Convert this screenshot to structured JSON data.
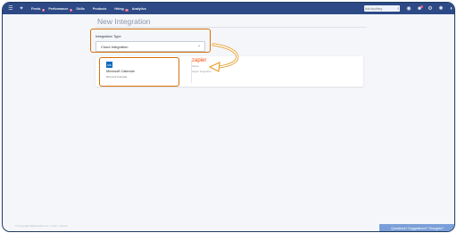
{
  "nav": {
    "items": [
      {
        "label": "Feeds",
        "badge": ""
      },
      {
        "label": "Performance",
        "badge": ""
      },
      {
        "label": "Skills",
        "badge": ""
      },
      {
        "label": "Products",
        "badge": ""
      },
      {
        "label": "Hiring",
        "badge": ""
      },
      {
        "label": "Analytics",
        "badge": ""
      }
    ]
  },
  "search": {
    "placeholder": "Ask Anything"
  },
  "page": {
    "title": "New Integration",
    "type_label": "Integration Type",
    "select_value": "Cloud Integration"
  },
  "cards": {
    "ms_icon_text": "MS",
    "ms_name": "Microsoft Calendar",
    "ms_sub": "Microsoft Calendar",
    "zapier_name": "zapier",
    "zapier_sub1": "Zapier",
    "zapier_sub2": "Zapier Integration"
  },
  "footer": {
    "copyright": "© Copyright Betterworks Inc. | Tech. | Terms",
    "button_label": "Questions? Suggestions? Thoughts?"
  },
  "colors": {
    "nav_bg": "#2d4a86",
    "highlight": "#d6700d",
    "accent": "#ff4a00"
  }
}
